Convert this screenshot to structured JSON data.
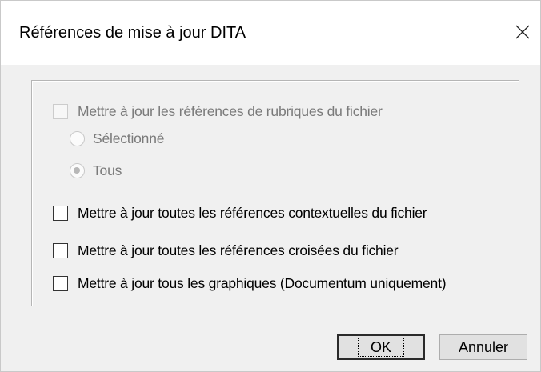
{
  "window": {
    "title": "Références de mise à jour DITA",
    "close_icon": "close-icon"
  },
  "options": {
    "topic_refs": {
      "label": "Mettre à jour les références de rubriques du fichier",
      "checked": false,
      "enabled": false
    },
    "scope": {
      "selected_label": "Sélectionné",
      "all_label": "Tous",
      "value": "Tous",
      "enabled": false
    },
    "context_refs": {
      "label": "Mettre à jour toutes les références contextuelles du fichier",
      "checked": false
    },
    "cross_refs": {
      "label": "Mettre à jour toutes les références croisées du fichier",
      "checked": false
    },
    "graphics": {
      "label": "Mettre à jour tous les graphiques (Documentum uniquement)",
      "checked": false
    }
  },
  "buttons": {
    "ok": "OK",
    "cancel": "Annuler"
  },
  "colors": {
    "dialog_bg": "#f0f0f0",
    "titlebar_bg": "#ffffff",
    "disabled_text": "#7a7a7a",
    "button_bg": "#e1e1e1"
  }
}
